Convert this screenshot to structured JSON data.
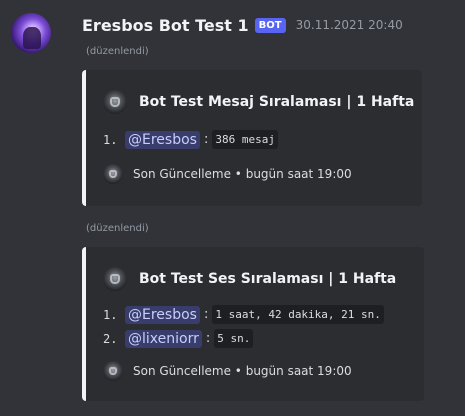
{
  "message": {
    "username": "Eresbos Bot Test 1",
    "bot_tag": "BOT",
    "timestamp": "30.11.2021 20:40"
  },
  "embeds": [
    {
      "edited_label": "(düzenlendi)",
      "author": "Bot Test Mesaj Sıralaması | 1 Hafta",
      "rows": [
        {
          "rank": "1.",
          "mention": "@Eresbos",
          "separator": ":",
          "value": "386 mesaj"
        }
      ],
      "footer": "Son Güncelleme • bugün saat 19:00"
    },
    {
      "edited_label": "(düzenlendi)",
      "author": "Bot Test Ses Sıralaması | 1 Hafta",
      "rows": [
        {
          "rank": "1.",
          "mention": "@Eresbos",
          "separator": ":",
          "value": "1 saat, 42 dakika, 21 sn."
        },
        {
          "rank": "2.",
          "mention": "@lixeniorr",
          "separator": ":",
          "value": "5 sn."
        }
      ],
      "footer": "Son Güncelleme • bugün saat 19:00"
    }
  ],
  "colors": {
    "background": "#313338",
    "embed_bg": "#2b2d31",
    "embed_border": "#f2f3f5",
    "bot_tag": "#5865f2",
    "mention_text": "#c9cdfb"
  }
}
